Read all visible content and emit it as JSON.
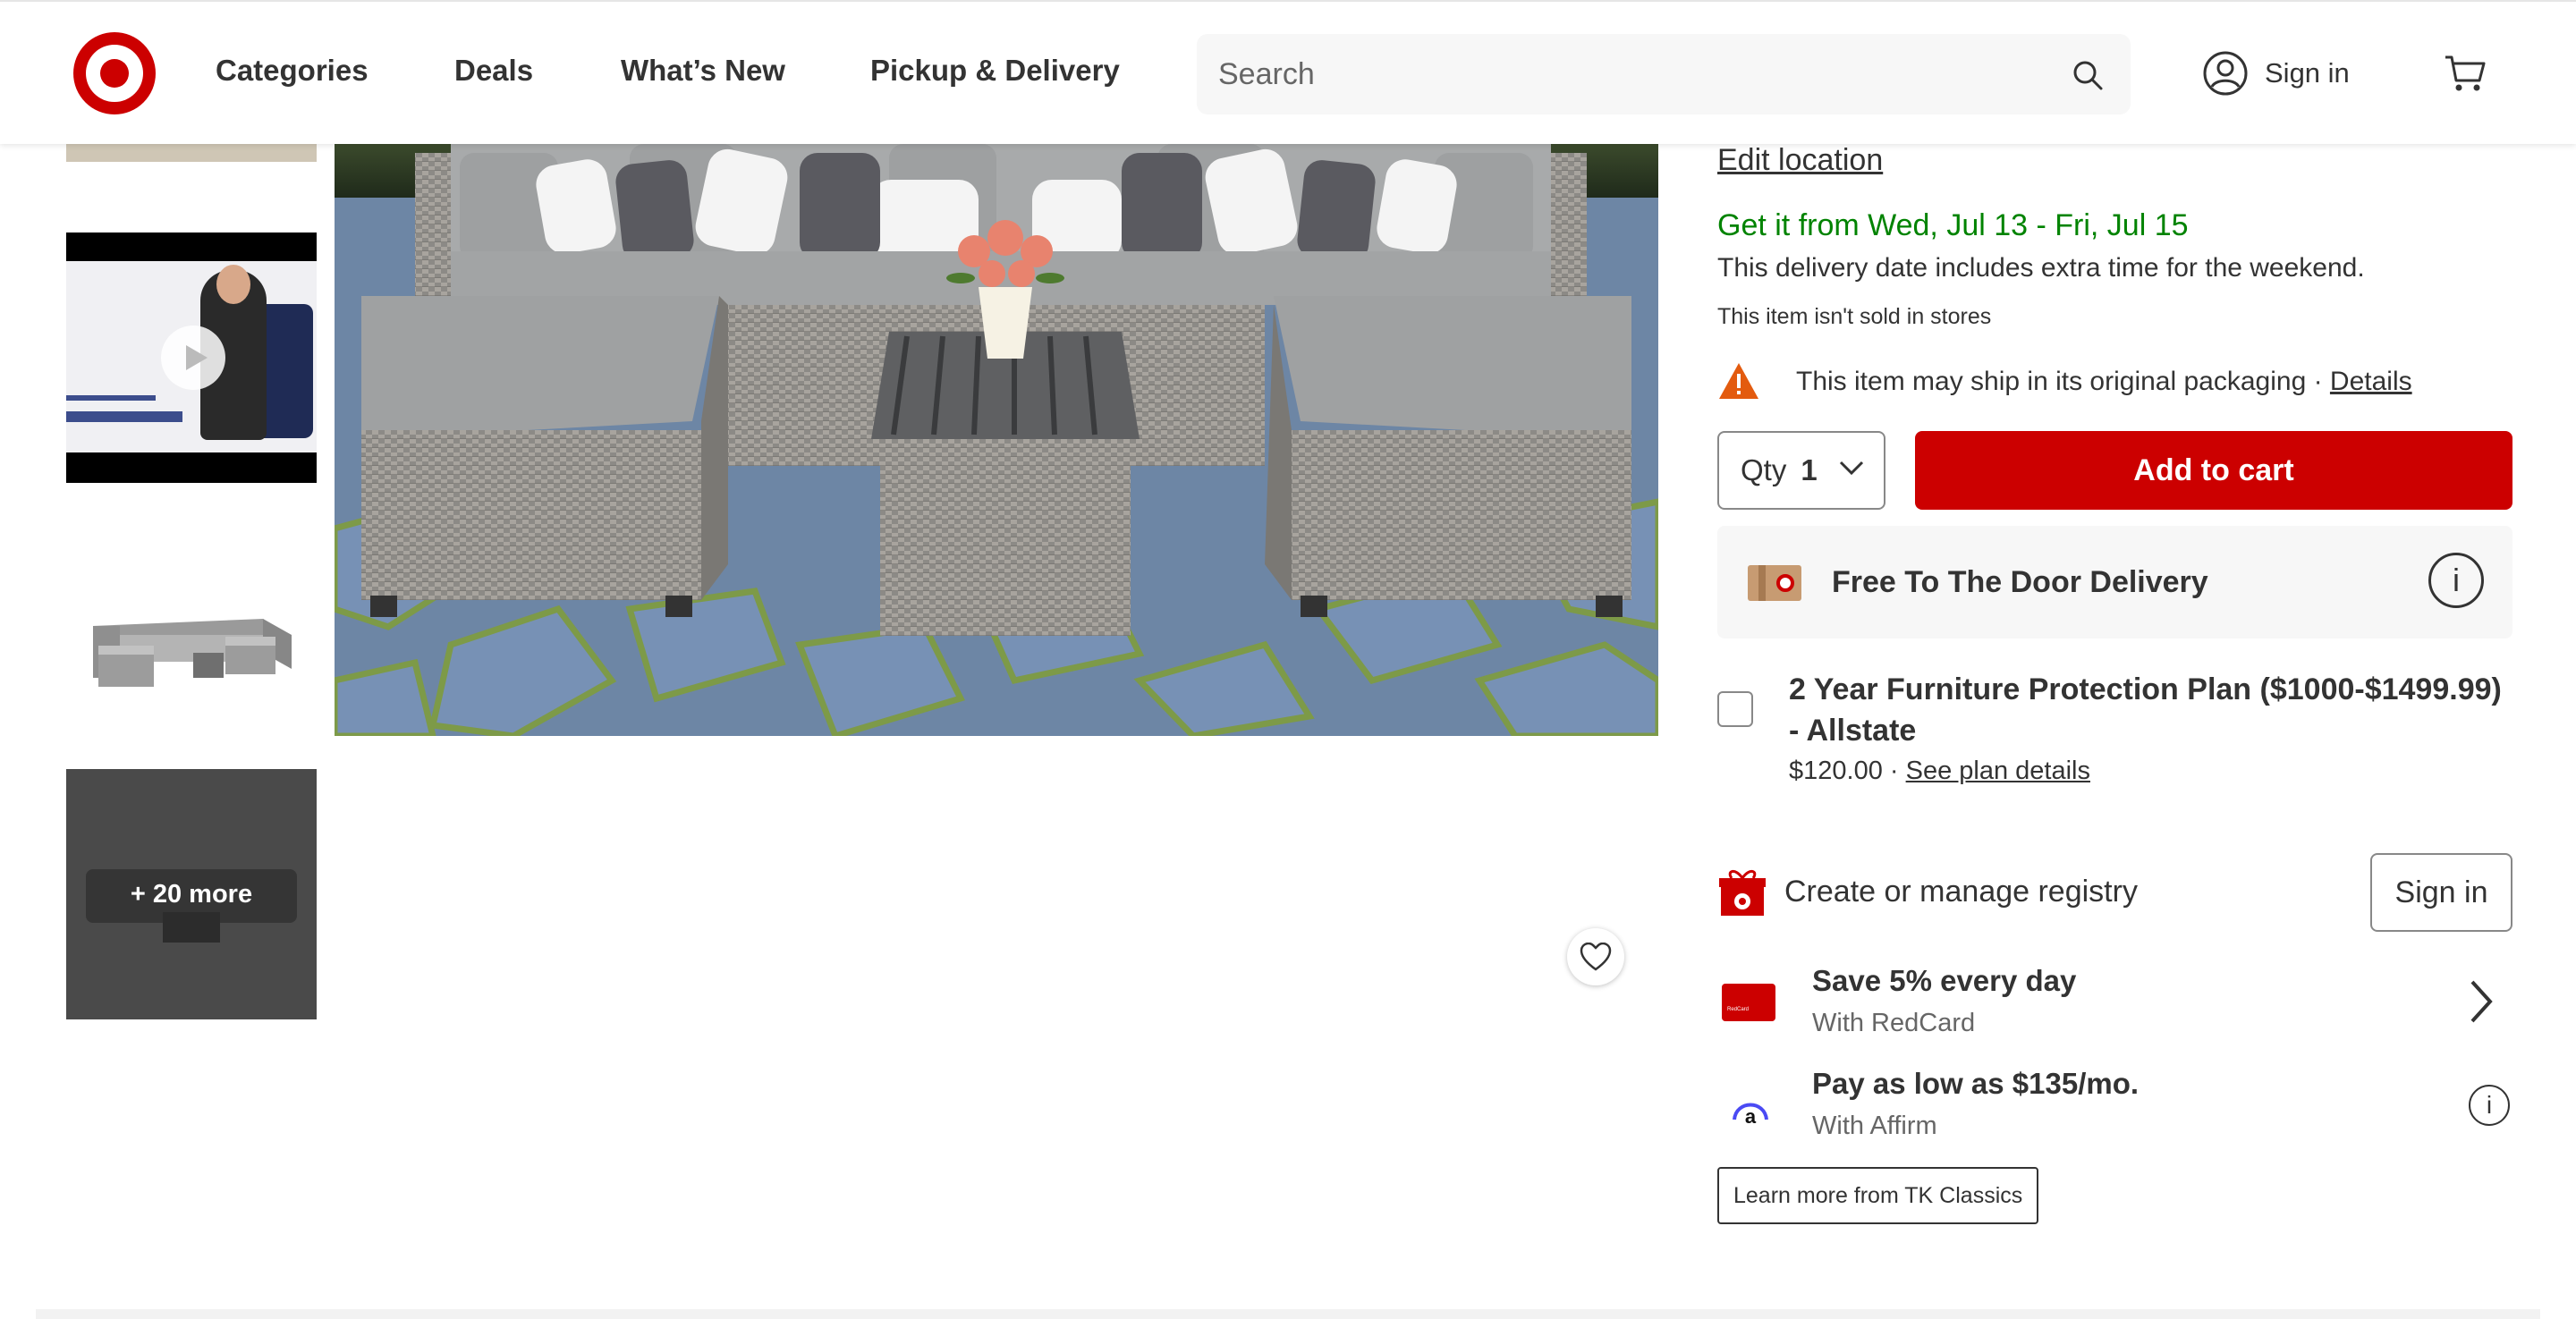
{
  "header": {
    "nav": [
      "Categories",
      "Deals",
      "What’s New",
      "Pickup & Delivery"
    ],
    "search_placeholder": "Search",
    "sign_in": "Sign in",
    "brand_color": "#cc0000",
    "icons": [
      "target-logo-icon",
      "search-icon",
      "account-icon",
      "cart-icon"
    ]
  },
  "gallery": {
    "more_label": "+ 20 more",
    "thumbnails": [
      "image",
      "video",
      "image",
      "more"
    ]
  },
  "fulfillment": {
    "edit_location": "Edit location",
    "delivery_window": "Get it from Wed, Jul 13 - Fri, Jul 15",
    "delivery_note": "This delivery date includes extra time for the weekend.",
    "not_in_stores": "This item isn't sold in stores",
    "packaging_text": "This item may ship in its original packaging",
    "packaging_sep": " · ",
    "packaging_link": "Details"
  },
  "purchase": {
    "qty_label": "Qty",
    "qty_value": "1",
    "add_to_cart": "Add to cart",
    "delivery_option": "Free To The Door Delivery"
  },
  "protection_plan": {
    "title": "2 Year Furniture Protection Plan ($1000-$1499.99) - Allstate",
    "price": "$120.00",
    "sep": " · ",
    "link": "See plan details"
  },
  "registry": {
    "label": "Create or manage registry",
    "sign_in": "Sign in"
  },
  "redcard": {
    "title": "Save 5% every day",
    "subtitle": "With RedCard"
  },
  "affirm": {
    "title": "Pay as low as $135/mo.",
    "subtitle": "With Affirm"
  },
  "learn_more": "Learn more from TK Classics",
  "colors": {
    "accent_red": "#cc0000",
    "delivery_green": "#008300",
    "warning_orange": "#e35b0f"
  }
}
